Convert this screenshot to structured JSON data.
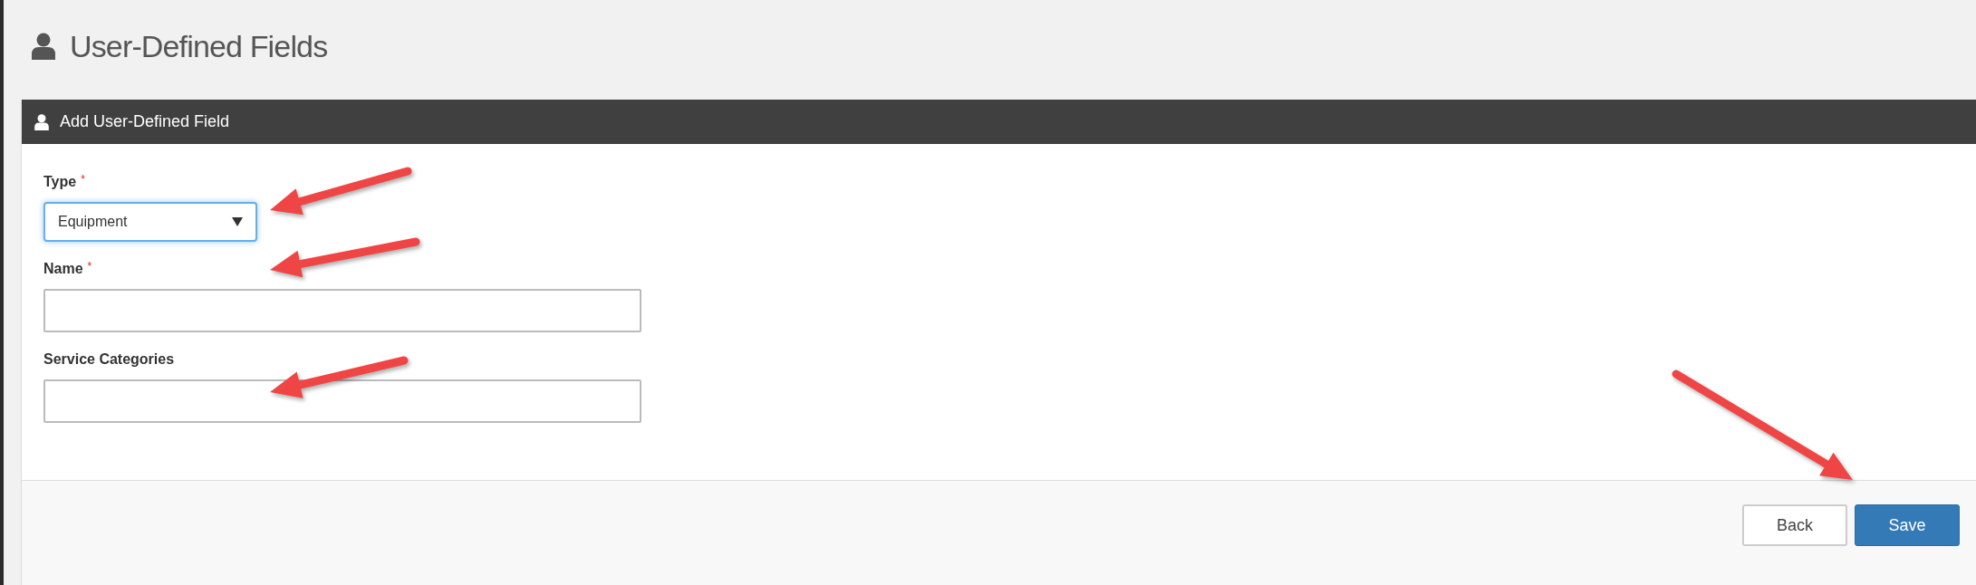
{
  "page": {
    "title": "User-Defined Fields"
  },
  "panel": {
    "title": "Add User-Defined Field",
    "fields": [
      {
        "kind": "select",
        "label": "Type",
        "required_mark": "*",
        "value": "Equipment",
        "focused": true
      },
      {
        "kind": "text",
        "label": "Name",
        "required_mark": "*",
        "focused": false
      },
      {
        "kind": "text",
        "label": "Service Categories",
        "focused": false
      }
    ],
    "buttons": [
      {
        "kind": "default",
        "label": "Back"
      },
      {
        "kind": "primary",
        "label": "Save"
      }
    ]
  }
}
